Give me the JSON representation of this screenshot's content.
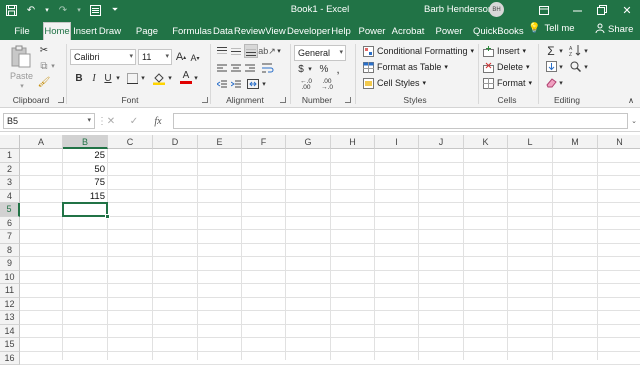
{
  "window": {
    "title": "Book1 - Excel",
    "user_name": "Barb Henderson",
    "user_initials": "BH"
  },
  "tabs": [
    {
      "label": "File"
    },
    {
      "label": "Home"
    },
    {
      "label": "Insert"
    },
    {
      "label": "Draw"
    },
    {
      "label": "Page Layout"
    },
    {
      "label": "Formulas"
    },
    {
      "label": "Data"
    },
    {
      "label": "Review"
    },
    {
      "label": "View"
    },
    {
      "label": "Developer"
    },
    {
      "label": "Help"
    },
    {
      "label": "Power BI"
    },
    {
      "label": "Acrobat"
    },
    {
      "label": "Power Pivot"
    },
    {
      "label": "QuickBooks"
    }
  ],
  "tell_me": "Tell me",
  "share": "Share",
  "ribbon": {
    "clipboard": {
      "label": "Clipboard",
      "paste": "Paste"
    },
    "font": {
      "label": "Font",
      "name": "Calibri",
      "size": "11"
    },
    "alignment": {
      "label": "Alignment"
    },
    "number": {
      "label": "Number",
      "format": "General"
    },
    "styles": {
      "label": "Styles",
      "conditional_formatting": "Conditional Formatting",
      "format_as_table": "Format as Table",
      "cell_styles": "Cell Styles"
    },
    "cells": {
      "label": "Cells",
      "insert": "Insert",
      "delete": "Delete",
      "format": "Format"
    },
    "editing": {
      "label": "Editing"
    }
  },
  "formula_bar": {
    "name_box": "B5",
    "fx": "fx",
    "value": ""
  },
  "columns": [
    "A",
    "B",
    "C",
    "D",
    "E",
    "F",
    "G",
    "H",
    "I",
    "J",
    "K",
    "L",
    "M",
    "N"
  ],
  "rows": [
    "1",
    "2",
    "3",
    "4",
    "5",
    "6",
    "7",
    "8",
    "9",
    "10",
    "11",
    "12",
    "13",
    "14",
    "15",
    "16"
  ],
  "cells": {
    "B1": "25",
    "B2": "50",
    "B3": "75",
    "B4": "115"
  },
  "active_cell": "B5",
  "colors": {
    "accent": "#217346"
  }
}
